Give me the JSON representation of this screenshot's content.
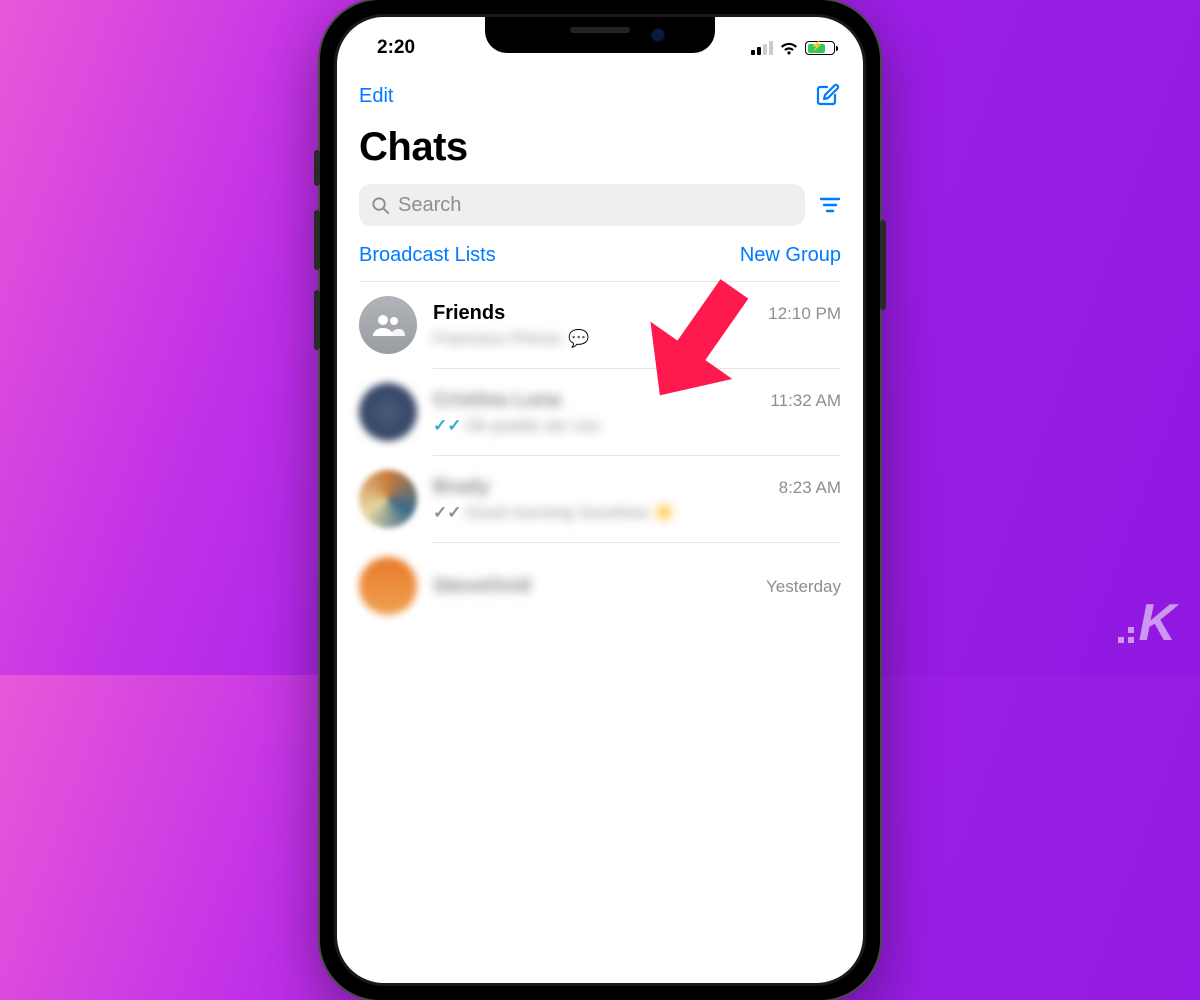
{
  "status": {
    "time": "2:20"
  },
  "nav": {
    "edit": "Edit"
  },
  "header": {
    "title": "Chats"
  },
  "search": {
    "placeholder": "Search"
  },
  "actions": {
    "broadcast": "Broadcast Lists",
    "newgroup": "New Group"
  },
  "chats": [
    {
      "name": "Friends",
      "time": "12:10 PM",
      "preview": "Francisco Prince:",
      "avatar": "group",
      "check": ""
    },
    {
      "name": "Cristina Luna",
      "time": "11:32 AM",
      "preview": "Ok puedo ser coo",
      "avatar": "blur1",
      "check": "blue",
      "blurred": true
    },
    {
      "name": "Brady",
      "time": "8:23 AM",
      "preview": "Good morning Sunshine ☀️",
      "avatar": "blur2",
      "check": "gray",
      "blurred": true
    },
    {
      "name": "SteveOvid",
      "time": "Yesterday",
      "preview": "",
      "avatar": "blur3",
      "check": "",
      "blurred": true
    }
  ],
  "watermark": "K"
}
